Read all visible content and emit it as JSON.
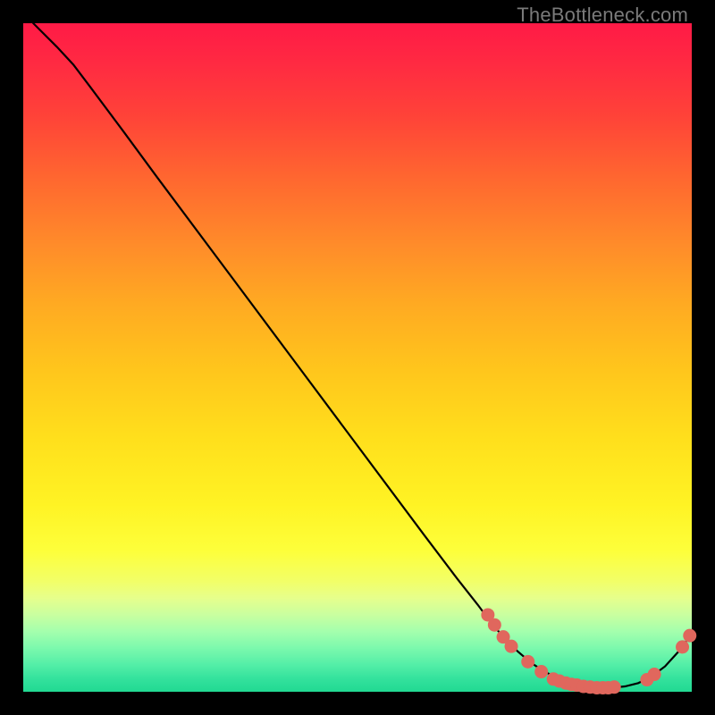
{
  "watermark": "TheBottleneck.com",
  "chart_data": {
    "type": "line",
    "title": "",
    "xlabel": "",
    "ylabel": "",
    "xlim": [
      0,
      1
    ],
    "ylim": [
      0,
      1
    ],
    "curve": {
      "name": "bottleneck-curve",
      "color": "#000000",
      "points": [
        {
          "x": 0.015,
          "y": 1.0
        },
        {
          "x": 0.03,
          "y": 0.985
        },
        {
          "x": 0.05,
          "y": 0.965
        },
        {
          "x": 0.075,
          "y": 0.938
        },
        {
          "x": 0.1,
          "y": 0.905
        },
        {
          "x": 0.15,
          "y": 0.838
        },
        {
          "x": 0.2,
          "y": 0.77
        },
        {
          "x": 0.3,
          "y": 0.636
        },
        {
          "x": 0.4,
          "y": 0.502
        },
        {
          "x": 0.5,
          "y": 0.368
        },
        {
          "x": 0.6,
          "y": 0.234
        },
        {
          "x": 0.65,
          "y": 0.168
        },
        {
          "x": 0.68,
          "y": 0.13
        },
        {
          "x": 0.7,
          "y": 0.103
        },
        {
          "x": 0.72,
          "y": 0.08
        },
        {
          "x": 0.74,
          "y": 0.06
        },
        {
          "x": 0.76,
          "y": 0.043
        },
        {
          "x": 0.78,
          "y": 0.03
        },
        {
          "x": 0.8,
          "y": 0.02
        },
        {
          "x": 0.82,
          "y": 0.013
        },
        {
          "x": 0.84,
          "y": 0.008
        },
        {
          "x": 0.86,
          "y": 0.006
        },
        {
          "x": 0.88,
          "y": 0.006
        },
        {
          "x": 0.9,
          "y": 0.008
        },
        {
          "x": 0.92,
          "y": 0.013
        },
        {
          "x": 0.94,
          "y": 0.023
        },
        {
          "x": 0.96,
          "y": 0.038
        },
        {
          "x": 0.98,
          "y": 0.06
        },
        {
          "x": 0.992,
          "y": 0.076
        },
        {
          "x": 1.0,
          "y": 0.09
        }
      ]
    },
    "markers": {
      "name": "data-points",
      "color": "#e0675d",
      "radius": 7.5,
      "points": [
        {
          "x": 0.695,
          "y": 0.115
        },
        {
          "x": 0.705,
          "y": 0.1
        },
        {
          "x": 0.718,
          "y": 0.082
        },
        {
          "x": 0.73,
          "y": 0.068
        },
        {
          "x": 0.755,
          "y": 0.045
        },
        {
          "x": 0.775,
          "y": 0.03
        },
        {
          "x": 0.793,
          "y": 0.019
        },
        {
          "x": 0.802,
          "y": 0.016
        },
        {
          "x": 0.812,
          "y": 0.013
        },
        {
          "x": 0.82,
          "y": 0.011
        },
        {
          "x": 0.828,
          "y": 0.01
        },
        {
          "x": 0.838,
          "y": 0.008
        },
        {
          "x": 0.848,
          "y": 0.007
        },
        {
          "x": 0.858,
          "y": 0.006
        },
        {
          "x": 0.867,
          "y": 0.006
        },
        {
          "x": 0.875,
          "y": 0.006
        },
        {
          "x": 0.884,
          "y": 0.007
        },
        {
          "x": 0.933,
          "y": 0.018
        },
        {
          "x": 0.944,
          "y": 0.026
        },
        {
          "x": 0.986,
          "y": 0.067
        },
        {
          "x": 0.997,
          "y": 0.084
        }
      ]
    }
  }
}
